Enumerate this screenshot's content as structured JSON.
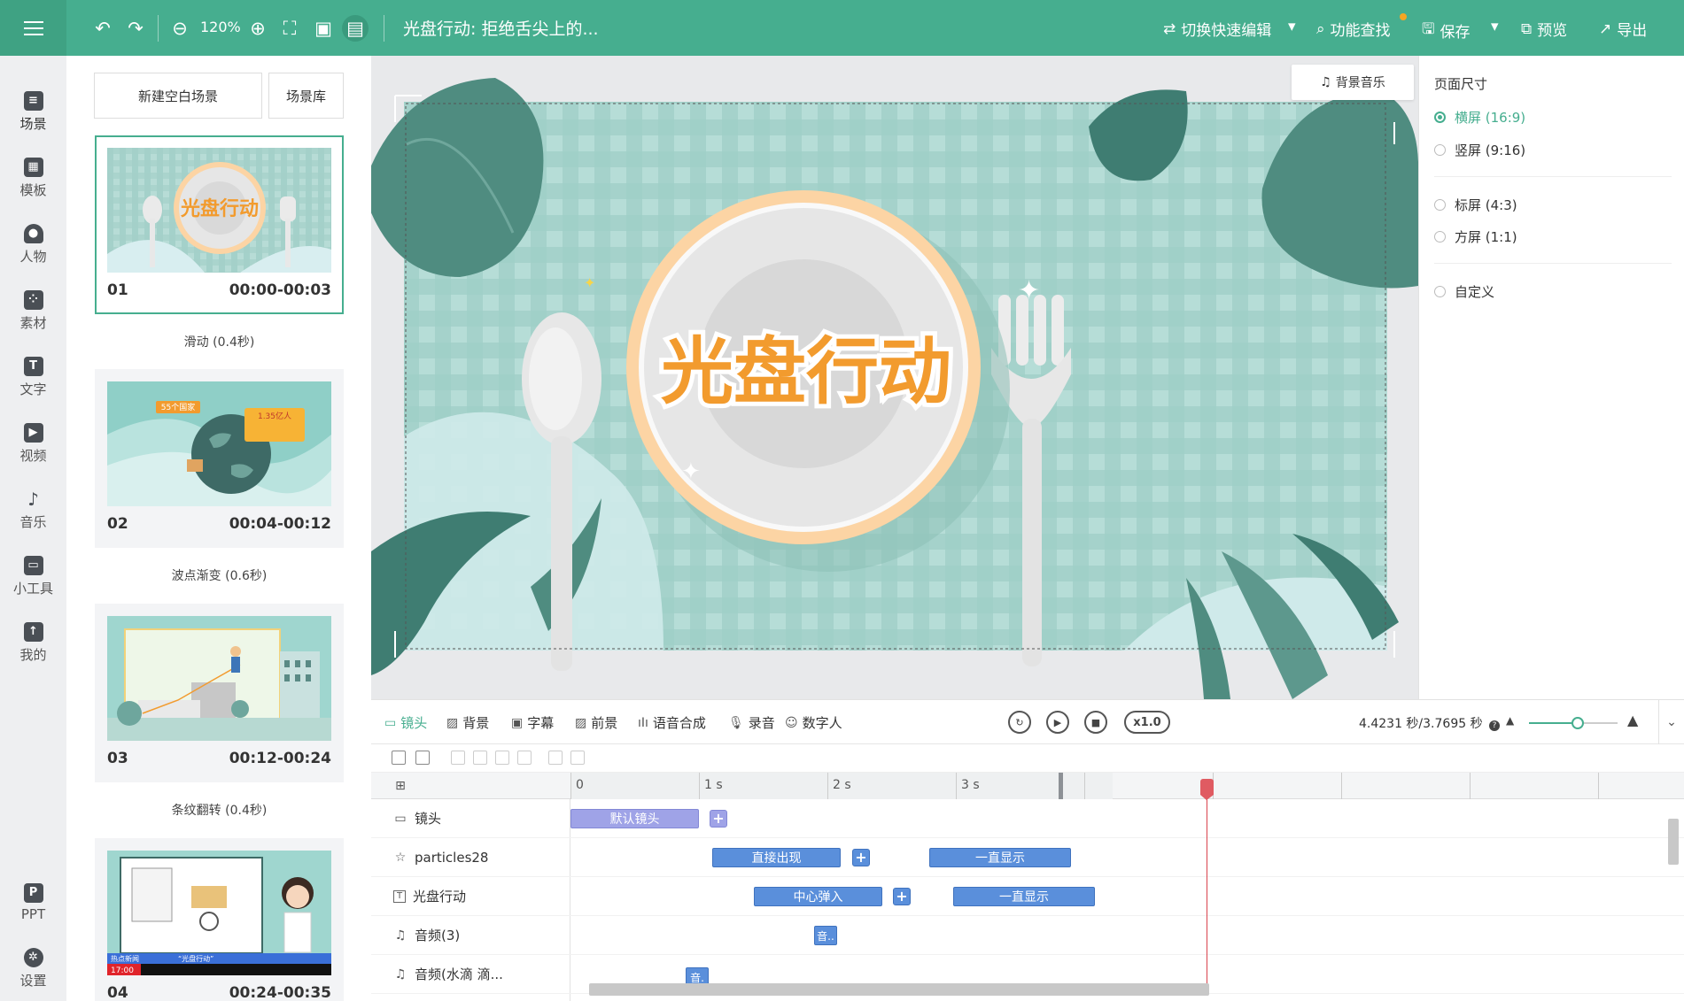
{
  "toolbar": {
    "zoom": "120%",
    "doc_title": "光盘行动: 拒绝舌尖上的...",
    "switch_fast_edit": "切换快速编辑",
    "feature_search": "功能查找",
    "save": "保存",
    "preview": "预览",
    "export": "导出"
  },
  "leftnav": {
    "items": [
      {
        "label": "场景",
        "icon": "scene-icon"
      },
      {
        "label": "模板",
        "icon": "template-icon"
      },
      {
        "label": "人物",
        "icon": "person-icon"
      },
      {
        "label": "素材",
        "icon": "material-icon"
      },
      {
        "label": "文字",
        "icon": "text-icon"
      },
      {
        "label": "视频",
        "icon": "video-icon"
      },
      {
        "label": "音乐",
        "icon": "music-icon"
      },
      {
        "label": "小工具",
        "icon": "toolbox-icon"
      },
      {
        "label": "我的",
        "icon": "upload-icon"
      }
    ],
    "bottom": [
      {
        "label": "PPT",
        "icon": "ppt-icon"
      },
      {
        "label": "设置",
        "icon": "settings-icon"
      }
    ]
  },
  "scenes": {
    "new_blank": "新建空白场景",
    "library": "场景库",
    "cards": [
      {
        "num": "01",
        "time": "00:00-00:03",
        "transition": "滑动 (0.4秒)",
        "thumb_text": "光盘行动"
      },
      {
        "num": "02",
        "time": "00:04-00:12",
        "transition": "波点渐变 (0.6秒)",
        "thumb_badge": "55个国家",
        "thumb_stat": "1.35亿人"
      },
      {
        "num": "03",
        "time": "00:12-00:24",
        "transition": "条纹翻转 (0.4秒)"
      },
      {
        "num": "04",
        "time": "00:24-00:35",
        "thumb_tv_label": "热点新闻",
        "thumb_tv_title": "“光盘行动”",
        "thumb_tv_time": "17:00"
      }
    ]
  },
  "canvas": {
    "bgm_button": "背景音乐",
    "title_text": "光盘行动",
    "colors": {
      "bg": "#a9d3cc",
      "plate_rim": "#fcd4a4",
      "title": "#f29b2e",
      "leaf": "#3f7d72"
    }
  },
  "page_size": {
    "title": "页面尺寸",
    "options": [
      {
        "label": "横屏 (16:9)",
        "checked": true
      },
      {
        "label": "竖屏 (9:16)",
        "checked": false
      },
      {
        "label": "标屏 (4:3)",
        "checked": false
      },
      {
        "label": "方屏 (1:1)",
        "checked": false
      },
      {
        "label": "自定义",
        "checked": false
      }
    ]
  },
  "timeline": {
    "tabs": [
      "镜头",
      "背景",
      "字幕",
      "前景",
      "语音合成",
      "录音",
      "数字人"
    ],
    "speed": "x1.0",
    "time_readout": "4.4231 秒/3.7695 秒",
    "zoom_level": 0.55,
    "ruler_labels": [
      "0",
      "1 s",
      "2 s",
      "3 s"
    ],
    "tracks": [
      {
        "label": "镜头",
        "icon": "camera-icon",
        "clips": [
          {
            "text": "默认镜头",
            "style": "purple"
          }
        ]
      },
      {
        "label": "particles28",
        "icon": "star-icon",
        "clips": [
          {
            "text": "直接出现"
          },
          {
            "text": "一直显示"
          }
        ]
      },
      {
        "label": "光盘行动",
        "icon": "text-icon",
        "clips": [
          {
            "text": "中心弹入"
          },
          {
            "text": "一直显示"
          }
        ]
      },
      {
        "label": "音频(3)",
        "icon": "music-note-icon",
        "clips": [
          {
            "text": "音.."
          }
        ]
      },
      {
        "label": "音频(水滴 滴...",
        "icon": "music-note-icon",
        "clips": [
          {
            "text": "音."
          }
        ]
      }
    ]
  }
}
